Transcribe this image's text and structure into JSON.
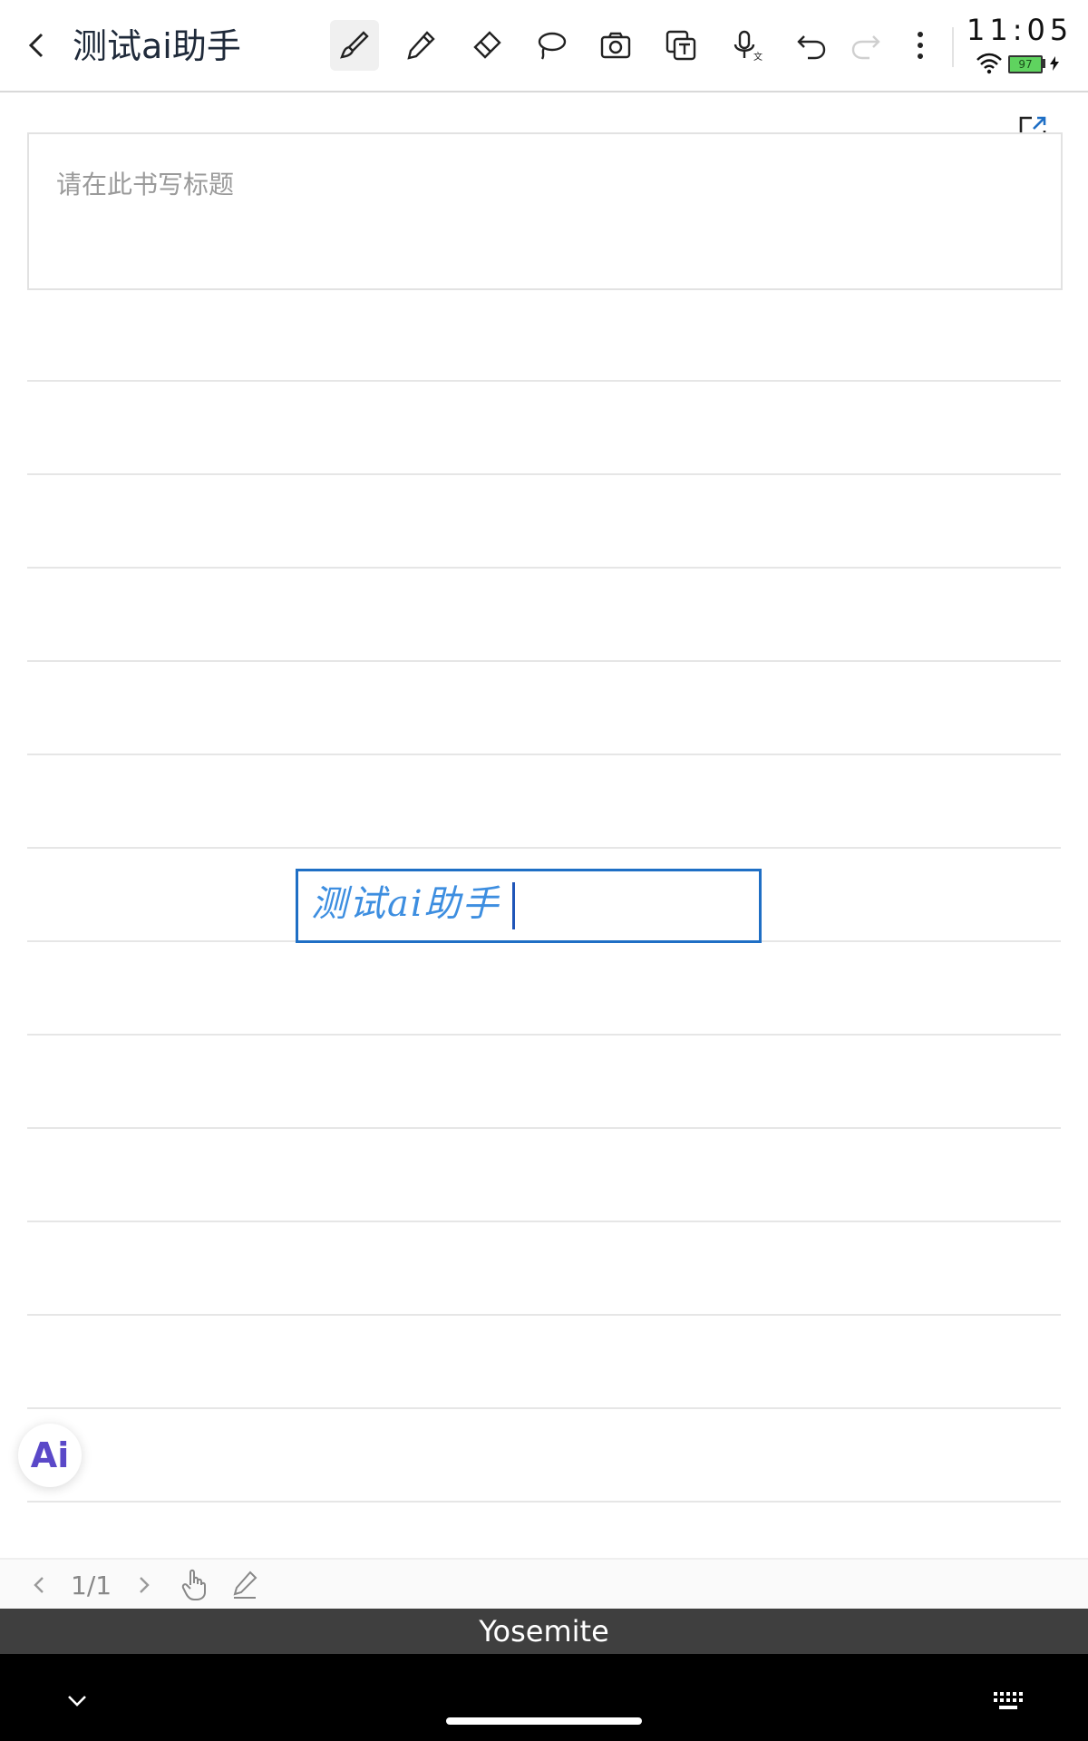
{
  "header": {
    "title": "测试ai助手",
    "tools": [
      {
        "name": "brush-tool",
        "active": true
      },
      {
        "name": "pen-tool"
      },
      {
        "name": "highlighter-tool"
      },
      {
        "name": "lasso-tool"
      },
      {
        "name": "camera-tool"
      },
      {
        "name": "text-recognition-tool"
      },
      {
        "name": "voice-input-tool"
      },
      {
        "name": "undo"
      },
      {
        "name": "redo",
        "enabled": false
      },
      {
        "name": "more-menu"
      }
    ]
  },
  "status_bar": {
    "time": "11:05",
    "battery": "97",
    "charging": true
  },
  "note": {
    "title_placeholder": "请在此书写标题",
    "handwriting_text": "测试ai助手"
  },
  "ai_button": {
    "label": "Ai"
  },
  "page_nav": {
    "indicator": "1/1"
  },
  "keyboard": {
    "suggestion": "Yosemite"
  },
  "colors": {
    "accent": "#1f6fc5",
    "ink": "#3d8ee0",
    "ai_gradient": "#5a48c8"
  }
}
